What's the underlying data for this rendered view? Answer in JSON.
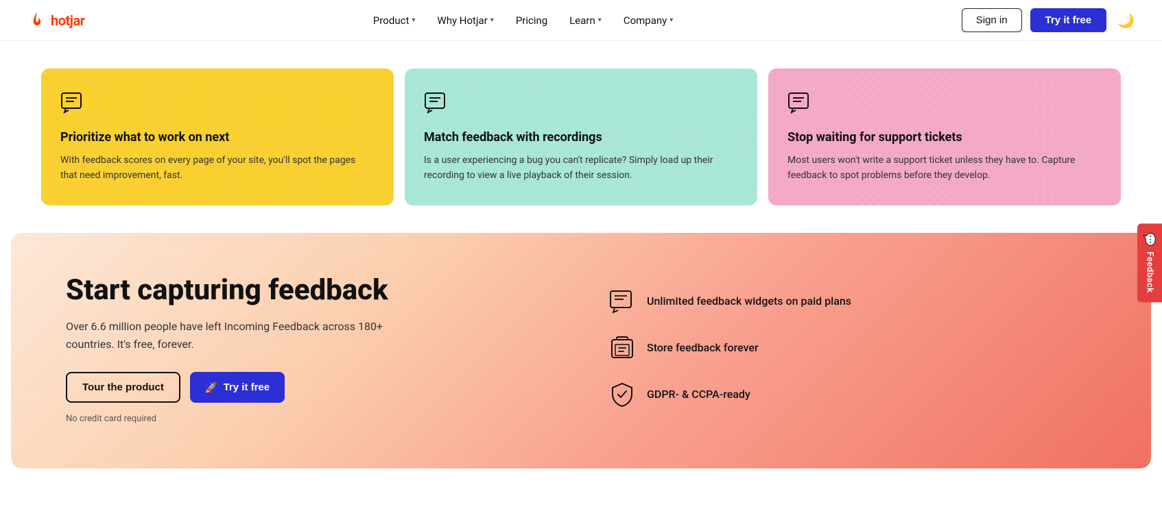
{
  "nav": {
    "logo_text": "hotjar",
    "links": [
      {
        "label": "Product",
        "has_chevron": true
      },
      {
        "label": "Why Hotjar",
        "has_chevron": true
      },
      {
        "label": "Pricing",
        "has_chevron": false
      },
      {
        "label": "Learn",
        "has_chevron": true
      },
      {
        "label": "Company",
        "has_chevron": true
      }
    ],
    "signin_label": "Sign in",
    "try_label": "Try it free"
  },
  "cards": [
    {
      "id": "card-yellow",
      "title": "Prioritize what to work on next",
      "desc": "With feedback scores on every page of your site, you'll spot the pages that need improvement, fast."
    },
    {
      "id": "card-teal",
      "title": "Match feedback with recordings",
      "desc": "Is a user experiencing a bug you can't replicate? Simply load up their recording to view a live playback of their session."
    },
    {
      "id": "card-pink",
      "title": "Stop waiting for support tickets",
      "desc": "Most users won't write a support ticket unless they have to. Capture feedback to spot problems before they develop."
    }
  ],
  "cta": {
    "title": "Start capturing feedback",
    "desc": "Over 6.6 million people have left Incoming Feedback across 180+ countries. It's free, forever.",
    "tour_label": "Tour the product",
    "try_label": "Try it free",
    "no_credit": "No credit card required",
    "features": [
      {
        "text": "Unlimited feedback widgets on paid plans"
      },
      {
        "text": "Store feedback forever"
      },
      {
        "text": "GDPR- & CCPA-ready"
      }
    ]
  },
  "feedback_tab": {
    "label": "Feedback"
  }
}
